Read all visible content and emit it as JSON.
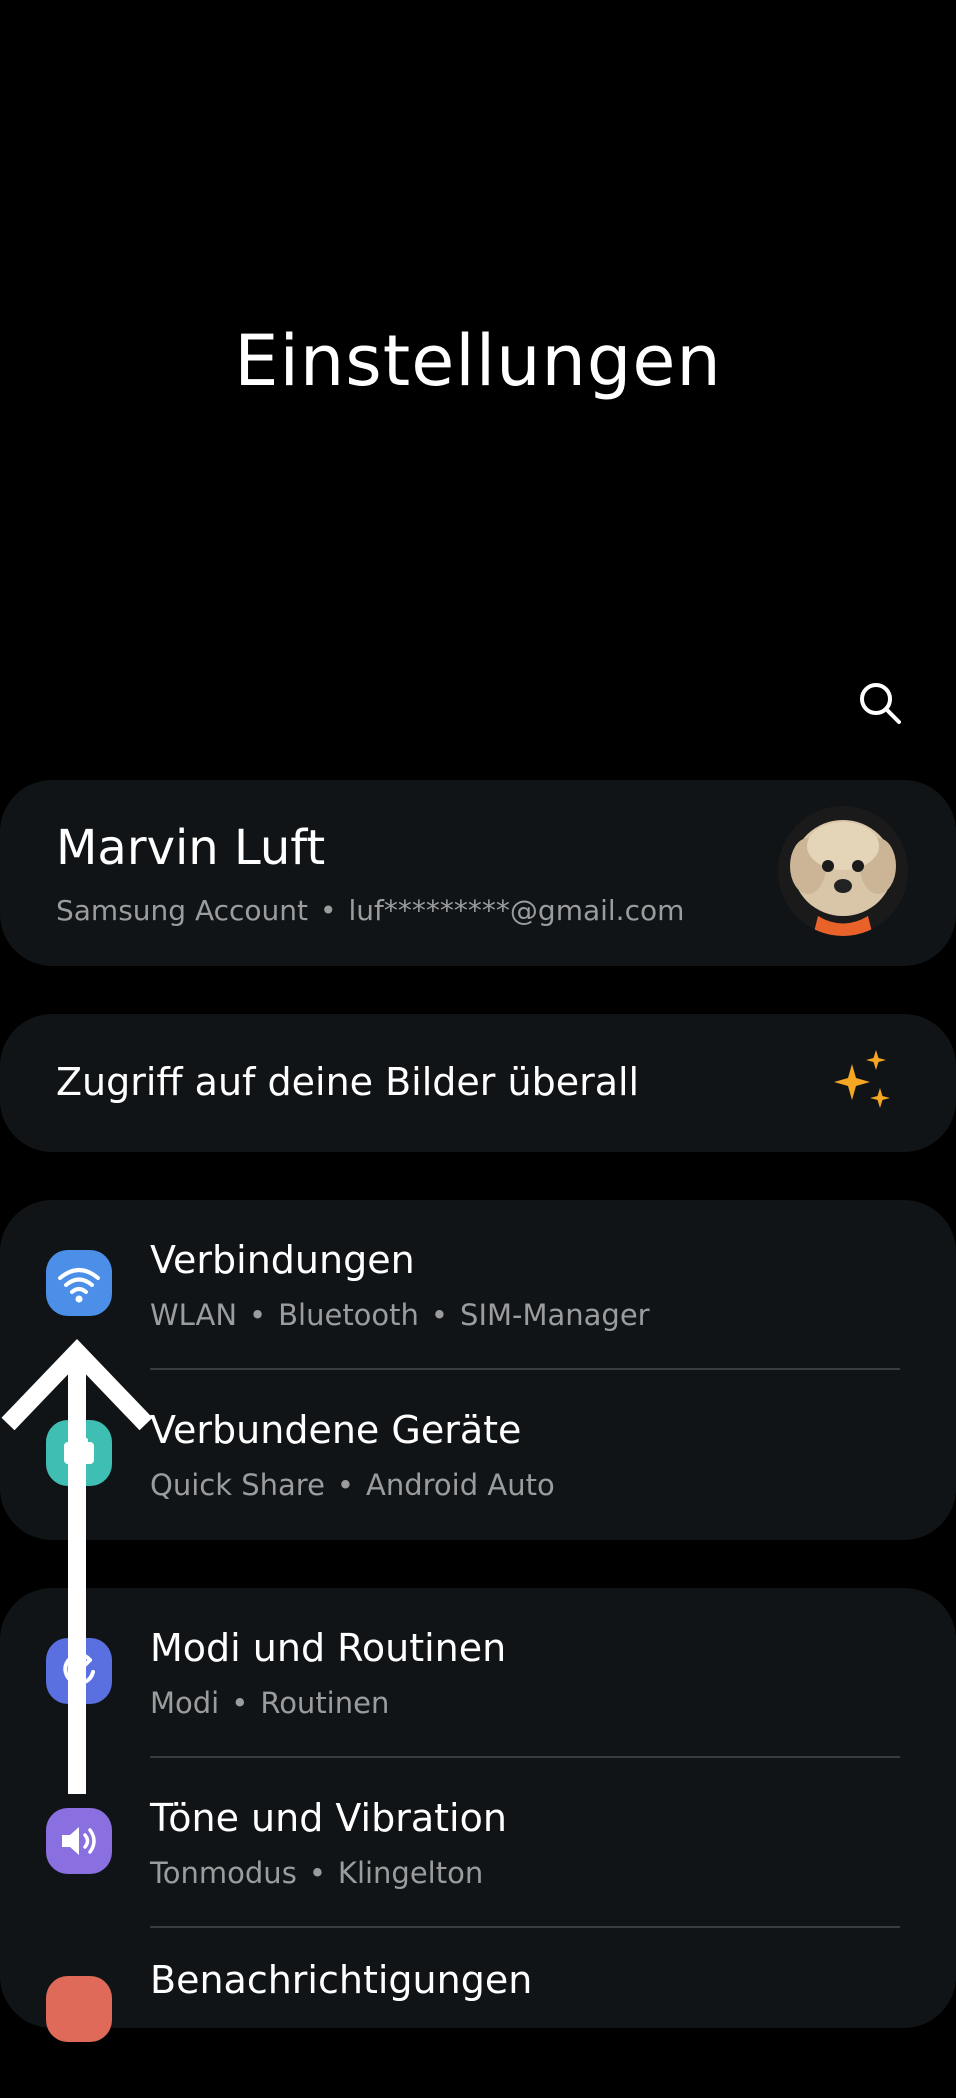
{
  "header": {
    "title": "Einstellungen",
    "search_icon": "search-icon"
  },
  "account": {
    "name": "Marvin Luft",
    "service": "Samsung Account",
    "separator": "•",
    "email": "luf*********@gmail.com",
    "avatar": "avatar-dog-photo"
  },
  "promo": {
    "text": "Zugriff auf deine Bilder überall",
    "icon": "sparkle-icon",
    "icon_color": "#f5a623"
  },
  "groups": [
    {
      "items": [
        {
          "title": "Verbindungen",
          "subtitle_parts": [
            "WLAN",
            "Bluetooth",
            "SIM-Manager"
          ],
          "icon": "wifi-icon",
          "icon_color": "#4b8fe8"
        },
        {
          "title": "Verbundene Geräte",
          "subtitle_parts": [
            "Quick Share",
            "Android Auto"
          ],
          "icon": "connected-devices-icon",
          "icon_color": "#3fbfb3"
        }
      ]
    },
    {
      "items": [
        {
          "title": "Modi und Routinen",
          "subtitle_parts": [
            "Modi",
            "Routinen"
          ],
          "icon": "modes-routines-icon",
          "icon_color": "#5a6fe0"
        },
        {
          "title": "Töne und Vibration",
          "subtitle_parts": [
            "Tonmodus",
            "Klingelton"
          ],
          "icon": "sound-icon",
          "icon_color": "#8a6fe0"
        },
        {
          "title": "Benachrichtigungen",
          "icon": "notifications-icon",
          "icon_color": "#e06a5a"
        }
      ]
    }
  ],
  "overlay": {
    "gesture": "swipe-up-arrow-icon"
  }
}
